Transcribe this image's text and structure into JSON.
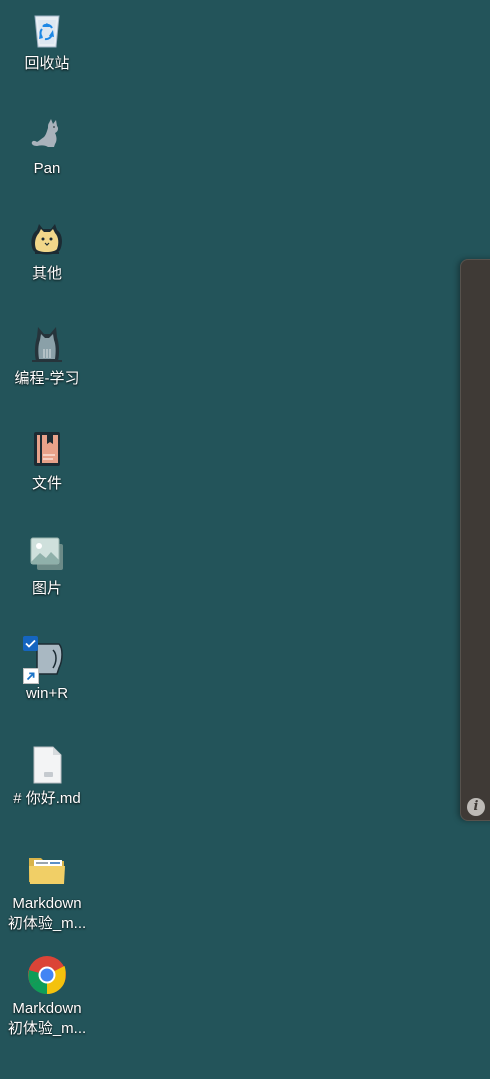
{
  "desktop": {
    "background_color": "#23545a",
    "icons": [
      {
        "label": "回收站",
        "icon": "recycle-bin-icon"
      },
      {
        "label": "Pan",
        "icon": "cat-silhouette-icon"
      },
      {
        "label": "其他",
        "icon": "yellow-cat-icon"
      },
      {
        "label": "编程-学习",
        "icon": "grey-cat-icon"
      },
      {
        "label": "文件",
        "icon": "book-icon"
      },
      {
        "label": "图片",
        "icon": "picture-icon"
      },
      {
        "label": "win+R",
        "icon": "shortcut-icon"
      },
      {
        "label": "# 你好.md",
        "icon": "markdown-file-icon"
      },
      {
        "label": "Markdown\n初体验_m...",
        "icon": "folder-icon"
      },
      {
        "label": "Markdown\n初体验_m...",
        "icon": "chrome-icon"
      }
    ]
  },
  "side_panel": {
    "background_color": "#3f3a36",
    "info_glyph": "i"
  }
}
